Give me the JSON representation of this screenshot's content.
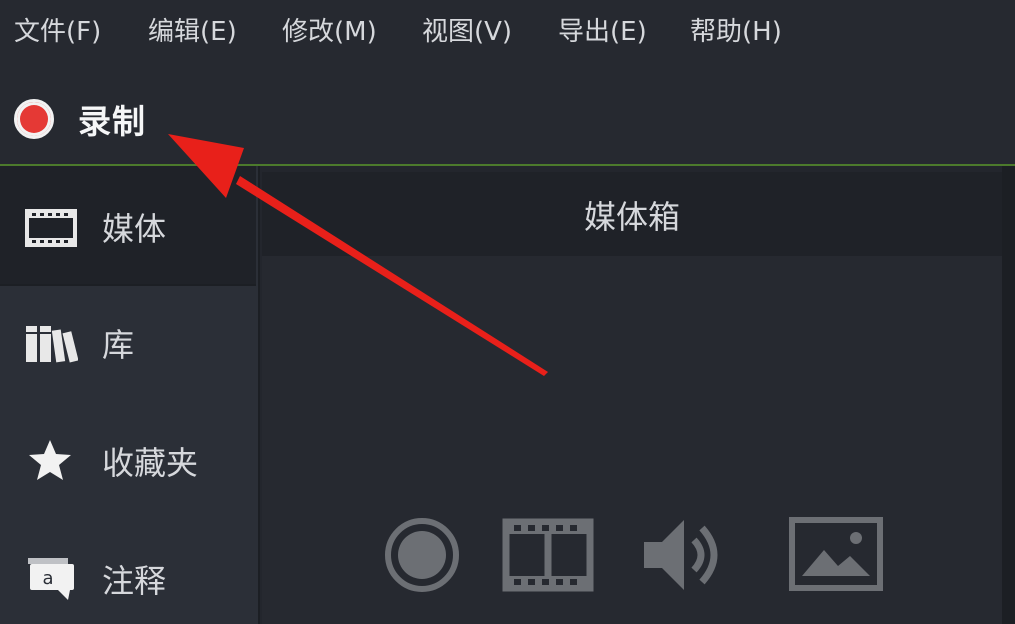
{
  "menubar": {
    "items": [
      {
        "label": "文件(F)"
      },
      {
        "label": "编辑(E)"
      },
      {
        "label": "修改(M)"
      },
      {
        "label": "视图(V)"
      },
      {
        "label": "导出(E)"
      },
      {
        "label": "帮助(H)"
      }
    ]
  },
  "toolbar": {
    "record_label": "录制",
    "record_color": "#e53935"
  },
  "sidebar": {
    "items": [
      {
        "label": "媒体",
        "icon": "film-strip-icon",
        "active": true
      },
      {
        "label": "库",
        "icon": "library-books-icon",
        "active": false
      },
      {
        "label": "收藏夹",
        "icon": "star-icon",
        "active": false
      },
      {
        "label": "注释",
        "icon": "annotation-bubble-icon",
        "active": false
      }
    ]
  },
  "panel": {
    "title": "媒体箱",
    "media_icons": [
      "record-circle-icon",
      "video-film-icon",
      "audio-speaker-icon",
      "image-icon"
    ]
  },
  "annotation": {
    "arrow_color": "#e8201a"
  }
}
